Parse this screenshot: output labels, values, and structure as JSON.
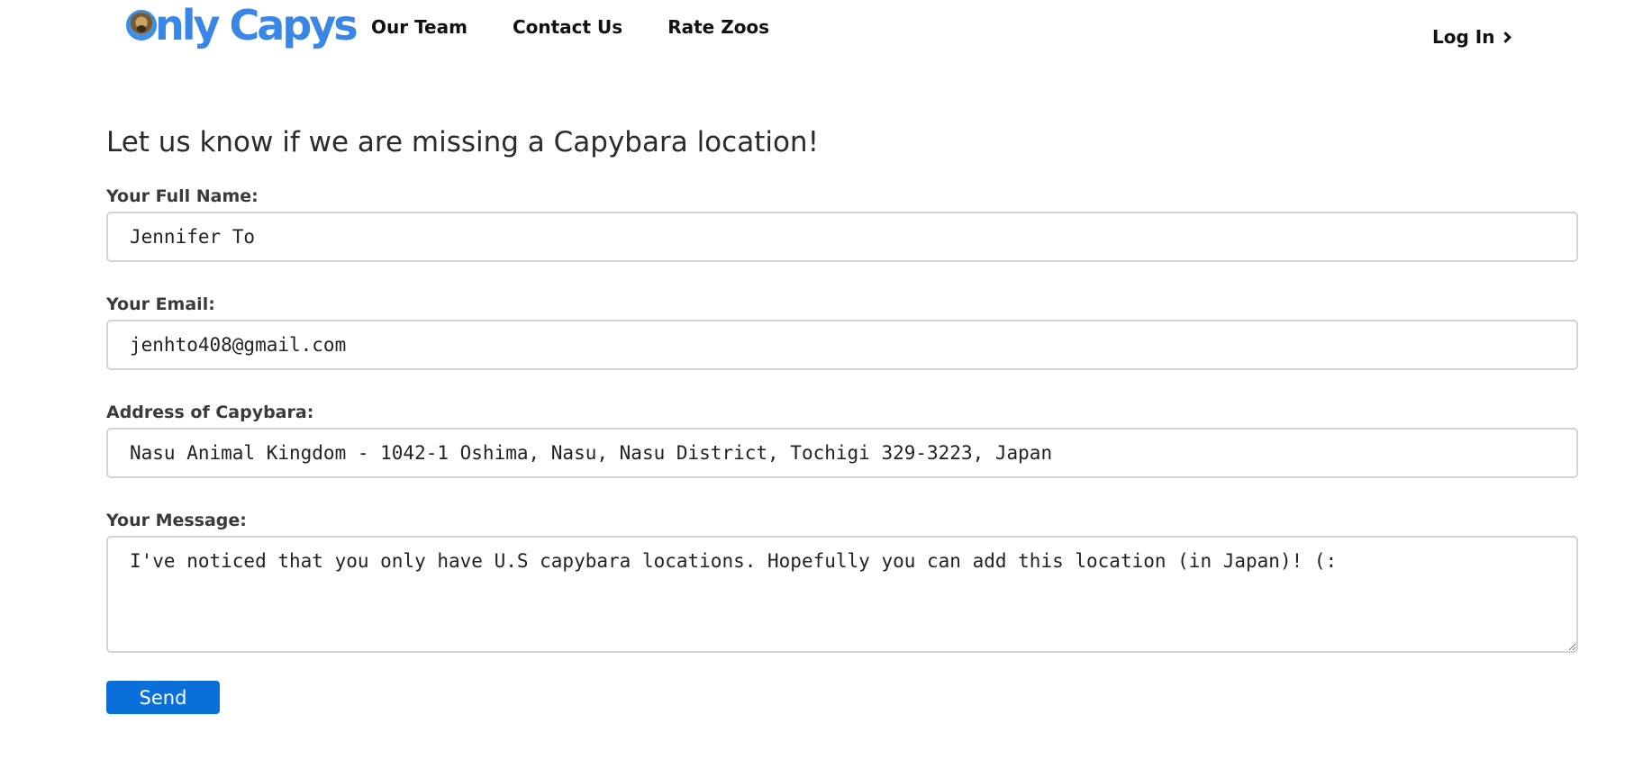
{
  "header": {
    "logo_text": "nly Capys",
    "nav": [
      {
        "label": "Our Team"
      },
      {
        "label": "Contact Us"
      },
      {
        "label": "Rate Zoos"
      }
    ],
    "login_label": "Log In"
  },
  "form": {
    "title": "Let us know if we are missing a Capybara location!",
    "name_label": "Your Full Name:",
    "name_value": "Jennifer To",
    "email_label": "Your Email:",
    "email_value": "jenhto408@gmail.com",
    "address_label": "Address of Capybara:",
    "address_value": "Nasu Animal Kingdom - 1042-1 Oshima, Nasu, Nasu District, Tochigi 329-3223, Japan",
    "message_label": "Your Message:",
    "message_value": "I've noticed that you only have U.S capybara locations. Hopefully you can add this location (in Japan)! (:",
    "send_label": "Send"
  },
  "colors": {
    "brand_blue": "#3a86e6",
    "button_blue": "#0a6fd8"
  },
  "icons": {
    "logo": "capybara-badge-icon",
    "login": "chevron-right-icon"
  }
}
